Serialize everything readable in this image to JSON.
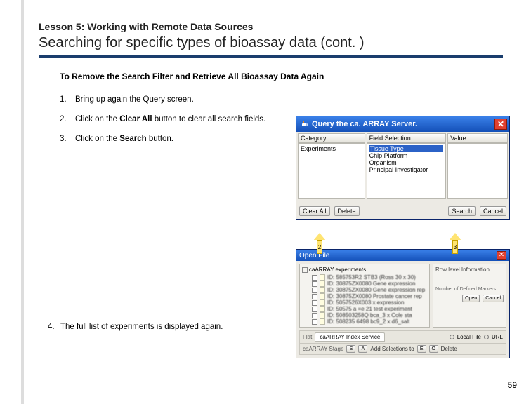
{
  "header": {
    "lesson": "Lesson 5: Working with Remote Data Sources",
    "title": "Searching for specific types of bioassay data (cont. )"
  },
  "subhead": "To Remove the Search Filter and Retrieve All Bioassay Data Again",
  "steps": [
    "Bring up again the Query screen.",
    "Click on the Clear All button to clear all search fields.",
    "Click on the Search button.",
    "The full list of experiments is displayed again."
  ],
  "stepLabels": {
    "clearAll": "Clear All",
    "search": "Search"
  },
  "win1": {
    "title": "Query the ca. ARRAY Server.",
    "headers": [
      "Category",
      "Field Selection",
      "Value"
    ],
    "categories": [
      "Experiments"
    ],
    "fields": [
      "Tissue Type",
      "Chip Platform",
      "Organism",
      "Principal Investigator"
    ],
    "buttons": {
      "clearAll": "Clear All",
      "delete": "Delete",
      "search": "Search",
      "cancel": "Cancel"
    }
  },
  "win2": {
    "title": "Open File",
    "root": "caARRAY experiments",
    "items": [
      "ID: 585753R2 STB3 (Ross 30 x 30)",
      "ID: 30875ZX0080 Gene expression",
      "ID: 30875ZX0080 Gene expression rep",
      "ID: 30875ZX0080 Prostate cancer rep",
      "ID: 5057526X003 x expression",
      "ID: 50575 a =e 21 test experiment",
      "ID: 508503258Q bca_3 x Cole sta",
      "ID: 508235 6498 bc9_2 x d6_salt"
    ],
    "preview": {
      "label": "Row level Information",
      "sub": "Number of Defined Markers",
      "open": "Open",
      "cancel": "Cancel"
    },
    "tabs": {
      "flat": "Flat",
      "index": "caARRAY Index Service",
      "localRadio": "Local File",
      "url": "URL"
    },
    "fileType": {
      "label": "caARRAY Stage",
      "btns": [
        "S",
        "A"
      ],
      "val": "Add Selections to",
      "b2": [
        "E",
        "O"
      ],
      "val2": "Delete"
    }
  },
  "callouts": {
    "c2": "2",
    "c3": "3"
  },
  "page": "59"
}
